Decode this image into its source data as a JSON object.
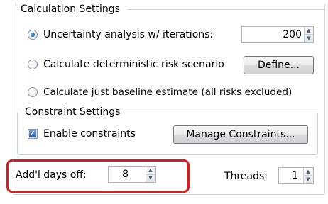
{
  "calc_settings": {
    "title": "Calculation Settings",
    "option_uncertainty": "Uncertainty analysis w/ iterations:",
    "iterations_value": "200",
    "option_deterministic": "Calculate deterministic risk scenario",
    "define_button": "Define...",
    "option_baseline": "Calculate just baseline estimate (all risks excluded)"
  },
  "constraint_settings": {
    "title": "Constraint Settings",
    "enable_label": "Enable constraints",
    "manage_button": "Manage Constraints..."
  },
  "days_off": {
    "label": "Add'l days off:",
    "value": "8"
  },
  "threads": {
    "label": "Threads:",
    "value": "1"
  },
  "colors": {
    "highlight": "#e01a1a",
    "radio_selected": "#1f5fa8",
    "checkbox_checked": "#2e5fa6"
  }
}
